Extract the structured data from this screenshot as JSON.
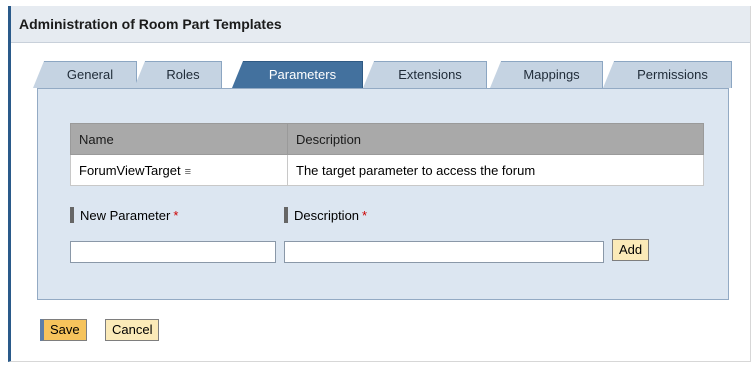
{
  "window": {
    "title": "Administration of Room Part Templates"
  },
  "tabs": [
    {
      "label": "General"
    },
    {
      "label": "Roles"
    },
    {
      "label": "Parameters"
    },
    {
      "label": "Extensions"
    },
    {
      "label": "Mappings"
    },
    {
      "label": "Permissions"
    }
  ],
  "active_tab": "Parameters",
  "table": {
    "columns": [
      "Name",
      "Description"
    ],
    "rows": [
      {
        "name": "ForumViewTarget",
        "description": "The target parameter to access the forum"
      }
    ]
  },
  "form": {
    "new_parameter_label": "New Parameter",
    "description_label": "Description",
    "required_marker": "*",
    "new_parameter_value": "",
    "description_value": "",
    "add_label": "Add"
  },
  "footer": {
    "save_label": "Save",
    "cancel_label": "Cancel"
  },
  "icons": {
    "hierarchy": "≡"
  },
  "colors": {
    "active_tab": "#43719e",
    "button": "#fbeab8",
    "primary_button": "#f6c35c"
  }
}
